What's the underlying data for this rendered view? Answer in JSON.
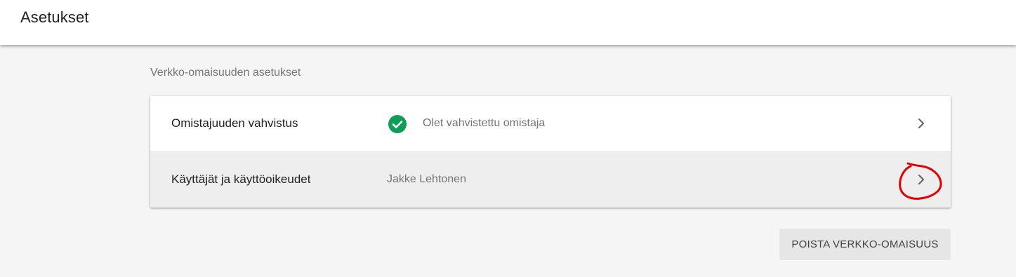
{
  "header": {
    "title": "Asetukset"
  },
  "section": {
    "title": "Verkko-omaisuuden asetukset"
  },
  "settings": {
    "rows": [
      {
        "label": "Omistajuuden vahvistus",
        "status_icon": "check-circle-icon",
        "value": "Olet vahvistettu omistaja",
        "action_icon": "chevron-right-icon"
      },
      {
        "label": "Käyttäjät ja käyttöoikeudet",
        "value": "Jakke Lehtonen",
        "action_icon": "chevron-right-icon"
      }
    ]
  },
  "actions": {
    "delete_label": "POISTA VERKKO-OMAISUUS"
  },
  "colors": {
    "success": "#0f9d58",
    "annotation": "#e00000",
    "page_background": "#f5f5f5"
  }
}
